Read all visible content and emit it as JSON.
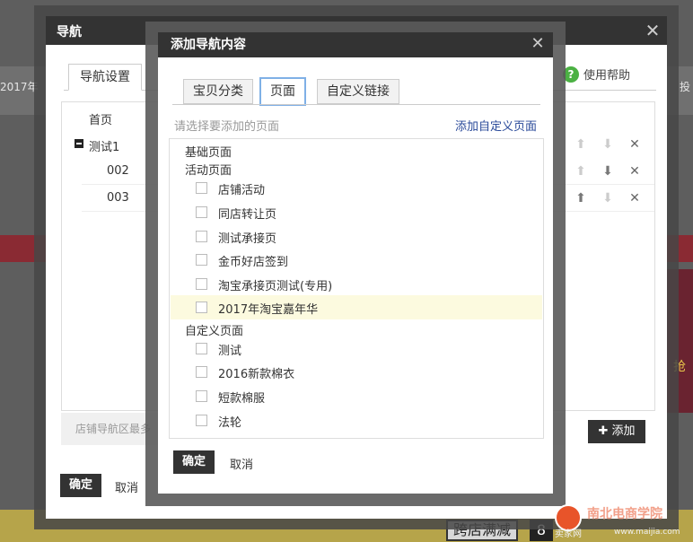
{
  "background": {
    "left_text": "2017年",
    "right_text": "投",
    "promo_text": "跨店满减",
    "promo_num": "8",
    "side_text": "抢"
  },
  "outer_dialog": {
    "title": "导航",
    "close": "✕",
    "tab": "导航设置",
    "help": "使用帮助",
    "rows": [
      {
        "label": "首页"
      },
      {
        "label": "测试1"
      },
      {
        "label": "002"
      },
      {
        "label": "003"
      }
    ],
    "bottom_note": "店铺导航区最多",
    "add_button": "添加",
    "ok": "确定",
    "cancel": "取消"
  },
  "inner_dialog": {
    "title": "添加导航内容",
    "close": "✕",
    "tabs": [
      "宝贝分类",
      "页面",
      "自定义链接"
    ],
    "hint": "请选择要添加的页面",
    "add_custom": "添加自定义页面",
    "groups": {
      "basic": "基础页面",
      "activity": "活动页面",
      "custom": "自定义页面"
    },
    "activity_pages": [
      "店铺活动",
      "同店转让页",
      "测试承接页",
      "金币好店签到",
      "淘宝承接页测试(专用)",
      "2017年淘宝嘉年华"
    ],
    "custom_pages": [
      "测试",
      "2016新款棉衣",
      "短款棉服",
      "法轮"
    ],
    "ok": "确定",
    "cancel": "取消"
  },
  "watermark": {
    "main": "南北电商学院",
    "sub": "卖家网",
    "sub2": "www.maijia.com"
  },
  "colors": {
    "header_dark": "#333333",
    "tab_active_border": "#7fb0e6",
    "link_blue": "#2a4a9a",
    "help_green": "#4bb143",
    "highlight_row": "#fcfadf"
  }
}
